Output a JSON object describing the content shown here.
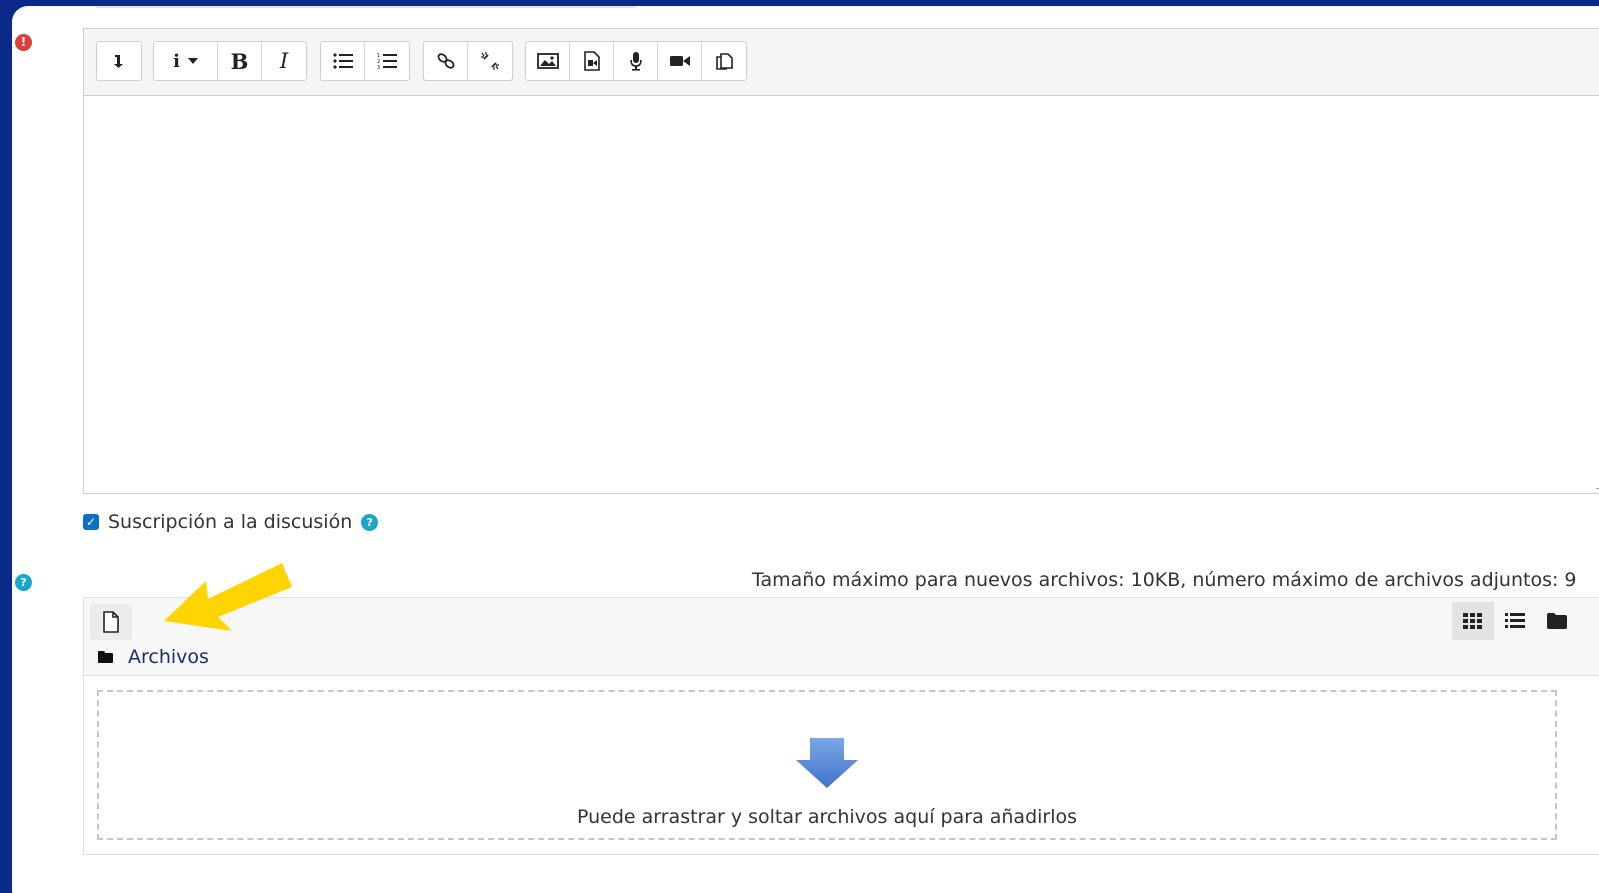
{
  "toolbar": {
    "buttons": [
      {
        "name": "expand-toolbar-icon",
        "glyph": "↴"
      },
      {
        "name": "paragraph-style-icon",
        "glyph": "i ▾"
      },
      {
        "name": "bold-icon",
        "glyph": "B"
      },
      {
        "name": "italic-icon",
        "glyph": "I"
      },
      {
        "name": "unordered-list-icon",
        "glyph": "☰"
      },
      {
        "name": "ordered-list-icon",
        "glyph": "≡"
      },
      {
        "name": "link-icon",
        "glyph": "🔗"
      },
      {
        "name": "unlink-icon",
        "glyph": "⛓"
      },
      {
        "name": "image-icon",
        "glyph": "▣"
      },
      {
        "name": "media-icon",
        "glyph": "▤"
      },
      {
        "name": "record-audio-icon",
        "glyph": "🎙"
      },
      {
        "name": "record-video-icon",
        "glyph": "■"
      },
      {
        "name": "manage-files-icon",
        "glyph": "⧉"
      }
    ]
  },
  "subscription": {
    "label": "Suscripción a la discusión",
    "checked": true
  },
  "attachments": {
    "max_size_text": "Tamaño máximo para nuevos archivos: 10KB, número máximo de archivos adjuntos: 9",
    "folder_label": "Archivos",
    "drop_text": "Puede arrastrar y soltar archivos aquí para añadirlos"
  },
  "colors": {
    "background": "#0a2a8a",
    "error": "#d9403a",
    "help": "#1aa6c8",
    "checkbox": "#0f6fc5",
    "annotation": "#ffd400",
    "drop_arrow": "#5b8fd8"
  }
}
